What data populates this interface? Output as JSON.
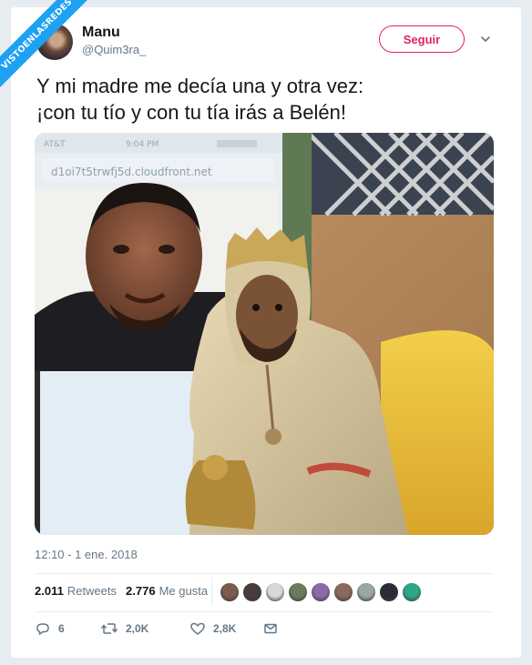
{
  "ribbon": {
    "text": "VISTOENLASREDES"
  },
  "user": {
    "name": "Manu",
    "handle": "@Quim3ra_"
  },
  "follow": {
    "label": "Seguir"
  },
  "tweet": {
    "lines": [
      "Y mi madre me decía una y otra vez:",
      "¡con tu tío y con tu tía irás a Belén!"
    ]
  },
  "photo": {
    "browser_url": "d1oi7t5trwfj5d.cloudfront.net",
    "status_time": "9:04 PM"
  },
  "timestamp": "12:10 - 1 ene. 2018",
  "stats": {
    "retweets_value": "2.011",
    "retweets_label": "Retweets",
    "likes_value": "2.776",
    "likes_label": "Me gusta"
  },
  "likers": [
    "#7a5b4c",
    "#4a3b3a",
    "#d8d8d8",
    "#6b7c5a",
    "#8c6aa8",
    "#8a6a5a",
    "#9aa8a0",
    "#2a2a3a",
    "#2fa58a"
  ],
  "actions": {
    "reply_count": "6",
    "retweet_count": "2,0K",
    "like_count": "2,8K"
  },
  "colors": {
    "accent": "#1da1f2",
    "follow": "#e0245e",
    "muted": "#657786"
  },
  "icons": [
    "caret-down-icon",
    "reply-icon",
    "retweet-icon",
    "heart-icon",
    "mail-icon"
  ]
}
